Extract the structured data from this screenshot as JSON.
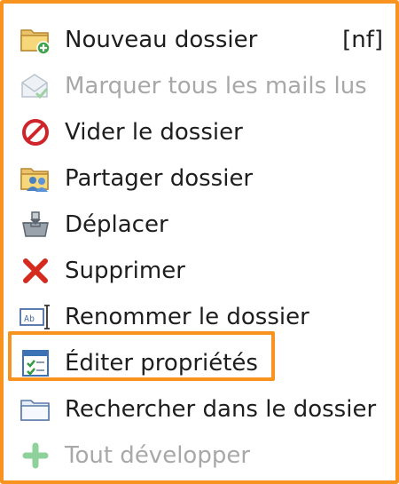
{
  "menu": {
    "accent_color": "#f7931e",
    "items": [
      {
        "label": "Nouveau dossier",
        "shortcut": "[nf]",
        "icon": "new-folder-icon",
        "enabled": true
      },
      {
        "label": "Marquer tous les mails lus",
        "icon": "mark-read-envelope-icon",
        "enabled": false
      },
      {
        "label": "Vider le dossier",
        "icon": "prohibited-icon",
        "enabled": true
      },
      {
        "label": "Partager dossier",
        "icon": "shared-folder-icon",
        "enabled": true
      },
      {
        "label": "Déplacer",
        "icon": "move-tray-icon",
        "enabled": true
      },
      {
        "label": "Supprimer",
        "icon": "delete-x-icon",
        "enabled": true
      },
      {
        "label": "Renommer le dossier",
        "icon": "rename-icon",
        "enabled": true
      },
      {
        "label": "Éditer propriétés",
        "icon": "properties-icon",
        "enabled": true,
        "highlighted": true
      },
      {
        "label": "Rechercher dans le dossier",
        "icon": "folder-icon",
        "enabled": true
      },
      {
        "label": "Tout développer",
        "icon": "plus-icon",
        "enabled": false
      }
    ]
  }
}
